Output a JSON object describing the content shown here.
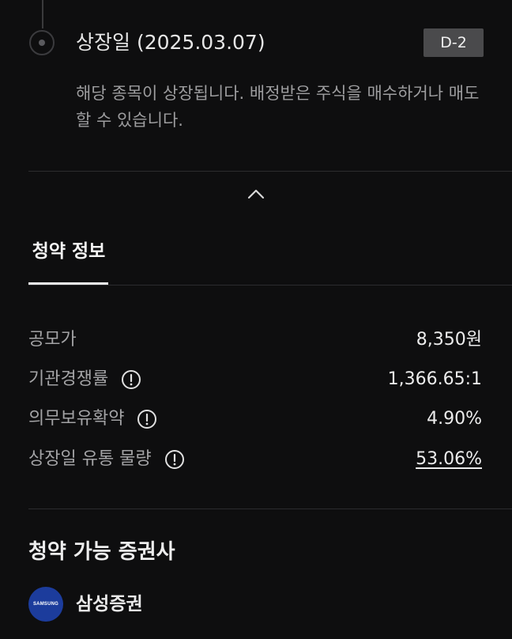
{
  "step": {
    "title": "상장일 (2025.03.07)",
    "badge": "D-2",
    "description": "해당 종목이 상장됩니다. 배정받은 주식을 매수하거나 매도할 수 있습니다."
  },
  "tabs": [
    {
      "label": "청약 정보",
      "active": true
    }
  ],
  "info": [
    {
      "label": "공모가",
      "value": "8,350원",
      "has_info_icon": false
    },
    {
      "label": "기관경쟁률",
      "value": "1,366.65:1",
      "has_info_icon": true
    },
    {
      "label": "의무보유확약",
      "value": "4.90%",
      "has_info_icon": true
    },
    {
      "label": "상장일 유통 물량",
      "value": "53.06%",
      "has_info_icon": true,
      "underlined": true
    }
  ],
  "brokers": {
    "title": "청약 가능 증권사",
    "items": [
      {
        "name": "삼성증권",
        "logo_text": "SAMSUNG",
        "logo_color": "#1c3c9c"
      }
    ]
  },
  "colors": {
    "background": "#0e0e0f",
    "badge_bg": "#4a4a4c",
    "divider": "#2c2c2e"
  }
}
